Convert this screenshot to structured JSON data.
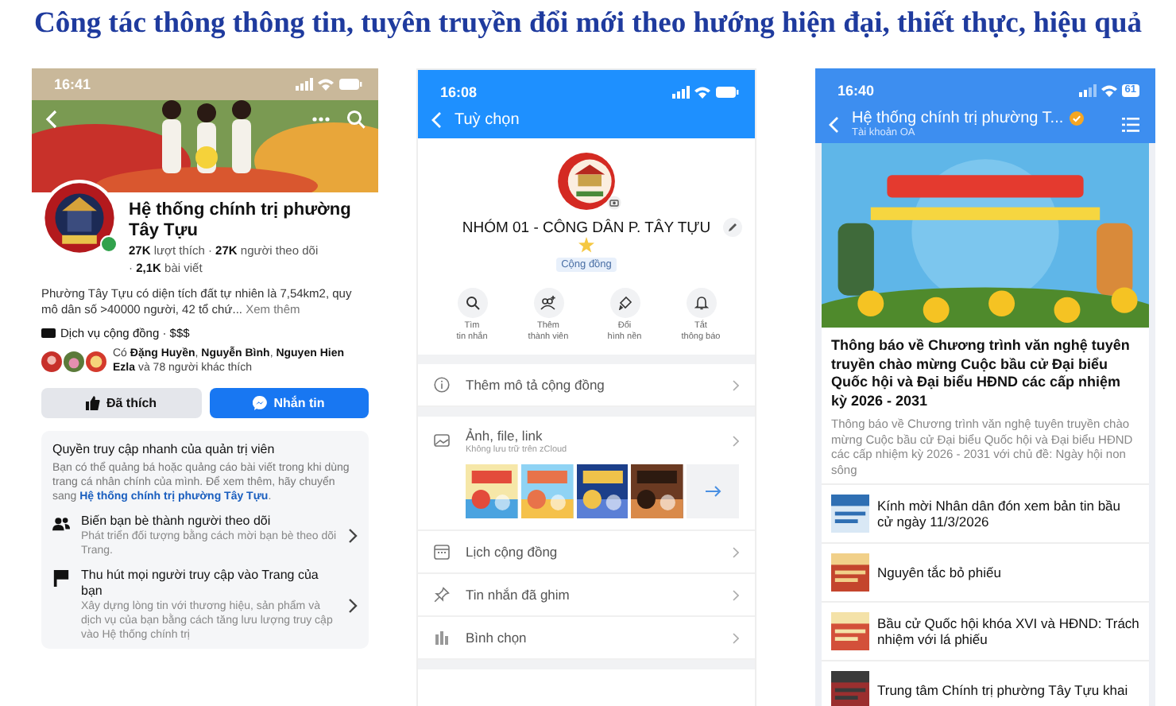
{
  "headline": "Công tác thông thông tin, tuyên truyền đổi mới theo hướng hiện đại, thiết thực, hiệu quả",
  "page_profile": {
    "time": "16:41",
    "name": "Hệ thống chính trị phường Tây Tựu",
    "stats": "**27K** lượt thích · **27K** người theo dõi",
    "posts": "· **2,1K** bài viết",
    "description": "Phường Tây Tựu có diện tích đất tự nhiên là 7,54km2, quy mô dân số >40000 người, 42 tổ chứ...",
    "see_more": "Xem thêm",
    "category": "Dịch vụ cộng đồng · $$$",
    "liked_by": "Có **Đặng Huyền**, **Nguyễn Bình**, **Nguyen Hien Ezla** và 78 người khác thích",
    "buttons": [
      {
        "label": "Đã thích",
        "kind": "like"
      },
      {
        "label": "Nhắn tin",
        "kind": "message"
      }
    ],
    "admin_card": {
      "title": "Quyền truy cập nhanh của quản trị viên",
      "body": "Bạn có thể quảng bá hoặc quảng cáo bài viết trong khi dùng trang cá nhân chính của mình. Để xem thêm, hãy chuyển sang **Hệ thống chính trị phường Tây Tựu**.",
      "items": [
        {
          "kind": "friends",
          "title": "Biến bạn bè thành người theo dõi",
          "desc": "Phát triển đối tượng bằng cách mời bạn bè theo dõi Trang."
        },
        {
          "kind": "flag",
          "title": "Thu hút mọi người truy cập vào Trang của bạn",
          "desc": "Xây dựng lòng tin với thương hiệu, sản phẩm và dịch vụ của bạn bằng cách tăng lưu lượng truy cập vào Hệ thống chính trị"
        }
      ]
    }
  },
  "group_options": {
    "time": "16:08",
    "title": "Tuỳ chọn",
    "name": "NHÓM 01 - CÔNG DÂN P. TÂY TỰU",
    "tag": "Cộng đồng",
    "actions": [
      {
        "kind": "search",
        "label": "Tìm\ntin nhắn"
      },
      {
        "kind": "add",
        "label": "Thêm\nthành viên"
      },
      {
        "kind": "brush",
        "label": "Đổi\nhình nền"
      },
      {
        "kind": "bell",
        "label": "Tắt\nthông báo"
      }
    ],
    "menu": [
      {
        "kind": "info",
        "label": "Thêm mô tả cộng đồng"
      },
      {
        "kind": "media",
        "label": "Ảnh, file, link",
        "sub": "Không lưu trữ trên zCloud"
      },
      {
        "kind": "calendar",
        "label": "Lịch cộng đồng"
      },
      {
        "kind": "pin",
        "label": "Tin nhắn đã ghim"
      },
      {
        "kind": "poll",
        "label": "Bình chọn"
      }
    ]
  },
  "official_account": {
    "time": "16:40",
    "battery": "61",
    "title": "Hệ thống chính trị phường T...",
    "subtitle": "Tài khoản OA",
    "article_title": "Thông báo về Chương trình văn nghệ tuyên truyền chào mừng Cuộc bầu cử Đại biểu Quốc hội và Đại biểu HĐND các cấp nhiệm kỳ 2026 - 2031",
    "article_summary": "Thông báo về Chương trình văn nghệ tuyên truyền chào mừng Cuộc bầu cử Đại biểu Quốc hội và Đại biểu HĐND các cấp nhiệm kỳ 2026 - 2031 với chủ đề: Ngày hội non sông",
    "articles": [
      {
        "title": "Kính mời Nhân dân đón xem bản tin bầu cử ngày 11/3/2026"
      },
      {
        "title": "Nguyên tắc bỏ phiếu"
      },
      {
        "title": "Bầu cử Quốc hội khóa XVI và HĐND: Trách nhiệm với lá phiếu"
      },
      {
        "title": "Trung tâm Chính trị phường Tây Tựu khai"
      }
    ]
  }
}
